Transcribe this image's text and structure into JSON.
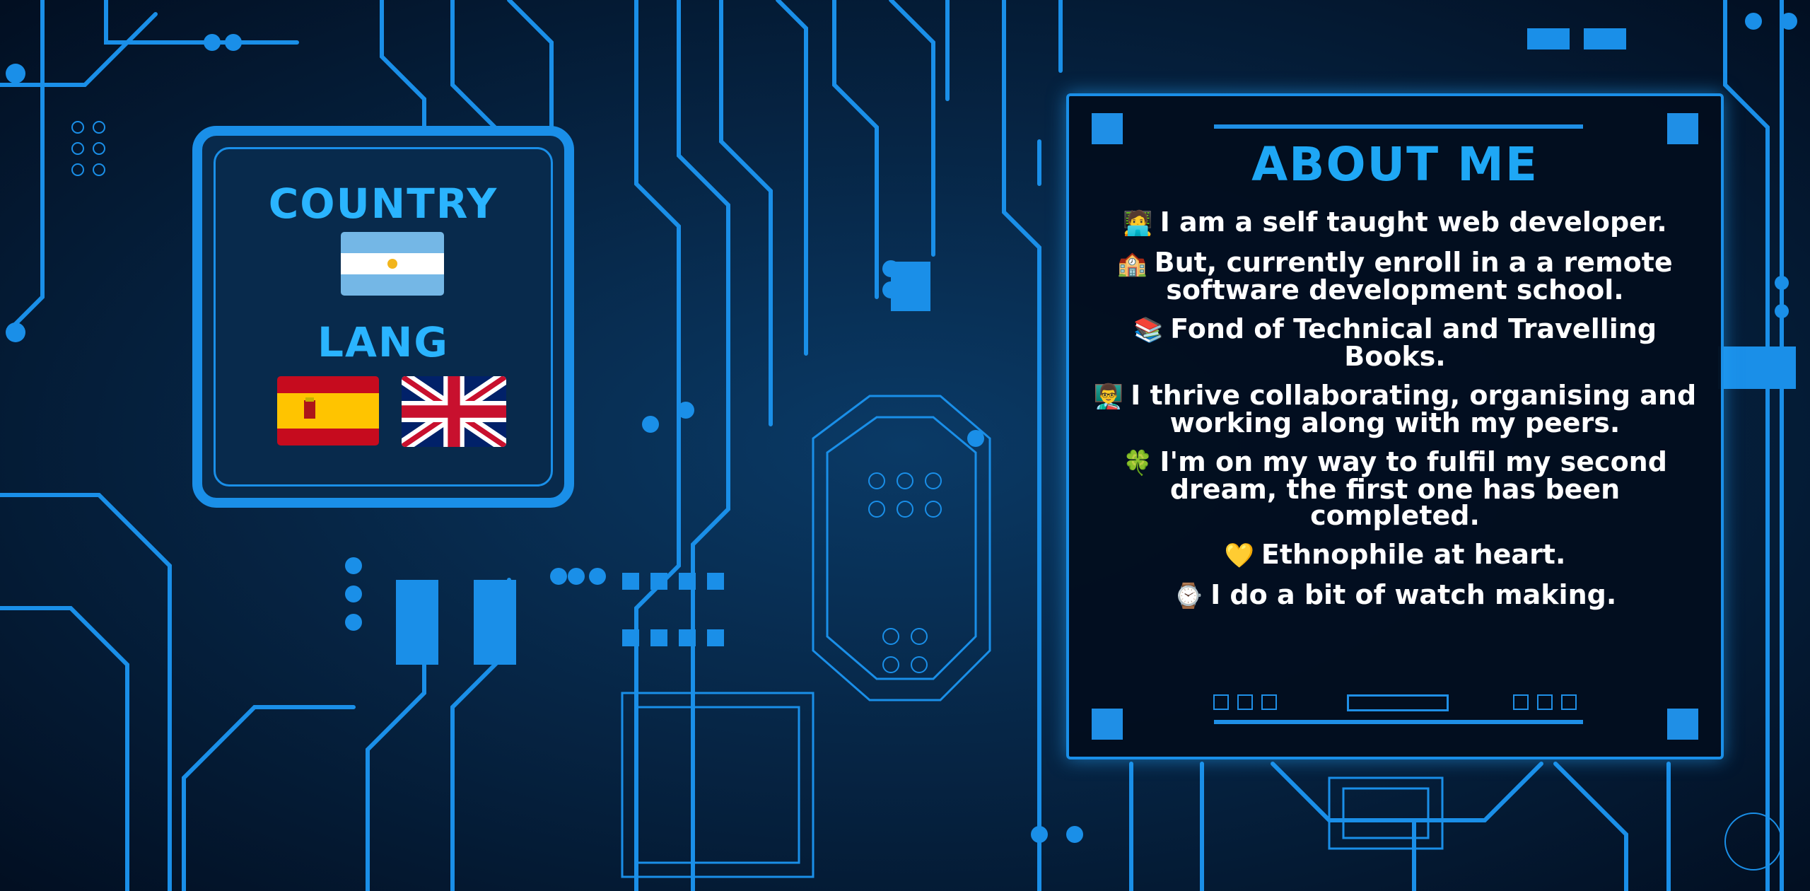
{
  "left_panel": {
    "country_heading": "COUNTRY",
    "country_flag": "argentina-flag",
    "lang_heading": "LANG",
    "lang_flags": [
      "spain-flag",
      "united-kingdom-flag"
    ]
  },
  "about": {
    "title": "ABOUT ME",
    "items": [
      {
        "emoji": "🧑‍💻",
        "icon": "developer-emoji",
        "text": "I am a self taught web developer."
      },
      {
        "emoji": "🏫",
        "icon": "school-emoji",
        "text": "But, currently enroll in a a remote software development school."
      },
      {
        "emoji": "📚",
        "icon": "books-emoji",
        "text": "Fond of Technical and Travelling Books."
      },
      {
        "emoji": "👨‍🏫",
        "icon": "teacher-emoji",
        "text": "I thrive collaborating, organising and working along with my peers."
      },
      {
        "emoji": "🍀",
        "icon": "clover-emoji",
        "text": "I'm on my way to fulfil my second dream, the first one has been completed."
      },
      {
        "emoji": "💛",
        "icon": "yellow-heart-emoji",
        "text": "Ethnophile at heart."
      },
      {
        "emoji": "⌚",
        "icon": "watch-emoji",
        "text": "I do a bit of watch making."
      }
    ]
  },
  "colors": {
    "background": "#041a33",
    "circuit": "#1a8fe8",
    "heading": "#2ab4ff",
    "panel": "#020e1e",
    "text": "#ffffff"
  }
}
